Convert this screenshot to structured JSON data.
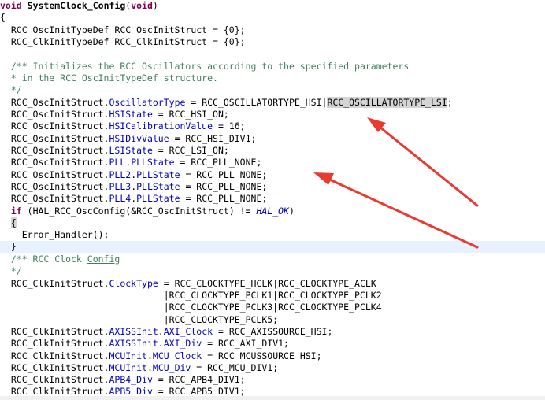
{
  "code": {
    "l0": {
      "kw": "void",
      "sp": " ",
      "fn": "SystemClock_Config",
      "open": "(",
      "arg": "void",
      "close": ")"
    },
    "l1": {
      "t": "{"
    },
    "l2": {
      "t": "  RCC_OscInitTypeDef RCC_OscInitStruct = {0};"
    },
    "l3": {
      "t": "  RCC_ClkInitTypeDef RCC_ClkInitStruct = {0};"
    },
    "l4": {
      "t": ""
    },
    "l5": {
      "t": "  /** Initializes the RCC Oscillators according to the specified parameters"
    },
    "l6": {
      "t": "  * in the RCC_OscInitTypeDef structure."
    },
    "l7": {
      "t": "  */"
    },
    "l8": {
      "obj": "  RCC_OscInitStruct.",
      "mem": "OscillatorType",
      "rest": " = RCC_OSCILLATORTYPE_HSI|",
      "sel": "RCC_OSCILLATORTYPE_LSI",
      "end": ";"
    },
    "l9": {
      "obj": "  RCC_OscInitStruct.",
      "mem": "HSIState",
      "rest": " = RCC_HSI_ON;"
    },
    "l10": {
      "obj": "  RCC_OscInitStruct.",
      "mem": "HSICalibrationValue",
      "rest": " = 16;"
    },
    "l11": {
      "obj": "  RCC_OscInitStruct.",
      "mem": "HSIDivValue",
      "rest": " = RCC_HSI_DIV1;"
    },
    "l12": {
      "obj": "  RCC_OscInitStruct.",
      "mem": "LSIState",
      "rest": " = RCC_LSI_ON;"
    },
    "l13": {
      "obj": "  RCC_OscInitStruct.",
      "mem": "PLL",
      "dot": ".",
      "mem2": "PLLState",
      "rest": " = RCC_PLL_NONE;"
    },
    "l14": {
      "obj": "  RCC_OscInitStruct.",
      "mem": "PLL2",
      "dot": ".",
      "mem2": "PLLState",
      "rest": " = RCC_PLL_NONE;"
    },
    "l15": {
      "obj": "  RCC_OscInitStruct.",
      "mem": "PLL3",
      "dot": ".",
      "mem2": "PLLState",
      "rest": " = RCC_PLL_NONE;"
    },
    "l16": {
      "obj": "  RCC_OscInitStruct.",
      "mem": "PLL4",
      "dot": ".",
      "mem2": "PLLState",
      "rest": " = RCC_PLL_NONE;"
    },
    "l17": {
      "pre": "  ",
      "kw": "if",
      "mid": " (HAL_RCC_OscConfig(&RCC_OscInitStruct) != ",
      "mac": "HAL_OK",
      "end": ")"
    },
    "l18": {
      "pre": "  ",
      "br": "{"
    },
    "l19": {
      "t": "    Error_Handler();"
    },
    "l20": {
      "t": "  }"
    },
    "l21": {
      "pre": "  /** RCC Clock ",
      "word": "Config"
    },
    "l22": {
      "t": "  */"
    },
    "l23": {
      "obj": "  RCC_ClkInitStruct.",
      "mem": "ClockType",
      "rest": " = RCC_CLOCKTYPE_HCLK|RCC_CLOCKTYPE_ACLK"
    },
    "l24": {
      "t": "                              |RCC_CLOCKTYPE_PCLK1|RCC_CLOCKTYPE_PCLK2"
    },
    "l25": {
      "t": "                              |RCC_CLOCKTYPE_PCLK3|RCC_CLOCKTYPE_PCLK4"
    },
    "l26": {
      "t": "                              |RCC_CLOCKTYPE_PCLK5;"
    },
    "l27": {
      "obj": "  RCC_ClkInitStruct.",
      "mem": "AXISSInit",
      "dot": ".",
      "mem2": "AXI_Clock",
      "rest": " = RCC_AXISSOURCE_HSI;"
    },
    "l28": {
      "obj": "  RCC_ClkInitStruct.",
      "mem": "AXISSInit",
      "dot": ".",
      "mem2": "AXI_Div",
      "rest": " = RCC_AXI_DIV1;"
    },
    "l29": {
      "obj": "  RCC_ClkInitStruct.",
      "mem": "MCUInit",
      "dot": ".",
      "mem2": "MCU_Clock",
      "rest": " = RCC_MCUSSOURCE_HSI;"
    },
    "l30": {
      "obj": "  RCC_ClkInitStruct.",
      "mem": "MCUInit",
      "dot": ".",
      "mem2": "MCU_Div",
      "rest": " = RCC_MCU_DIV1;"
    },
    "l31": {
      "obj": "  RCC_ClkInitStruct.",
      "mem": "APB4_Div",
      "rest": " = RCC_APB4_DIV1;"
    },
    "l32": {
      "obj": "  RCC_ClkInitStruct.",
      "mem": "APB5_Div",
      "rest": " = RCC_APB5_DIV1;"
    }
  },
  "colors": {
    "keyword": "#7f0055",
    "member": "#0000c0",
    "comment": "#3f7f5f",
    "annotation_arrow": "#e83a30",
    "current_line": "#e8f2fe"
  }
}
